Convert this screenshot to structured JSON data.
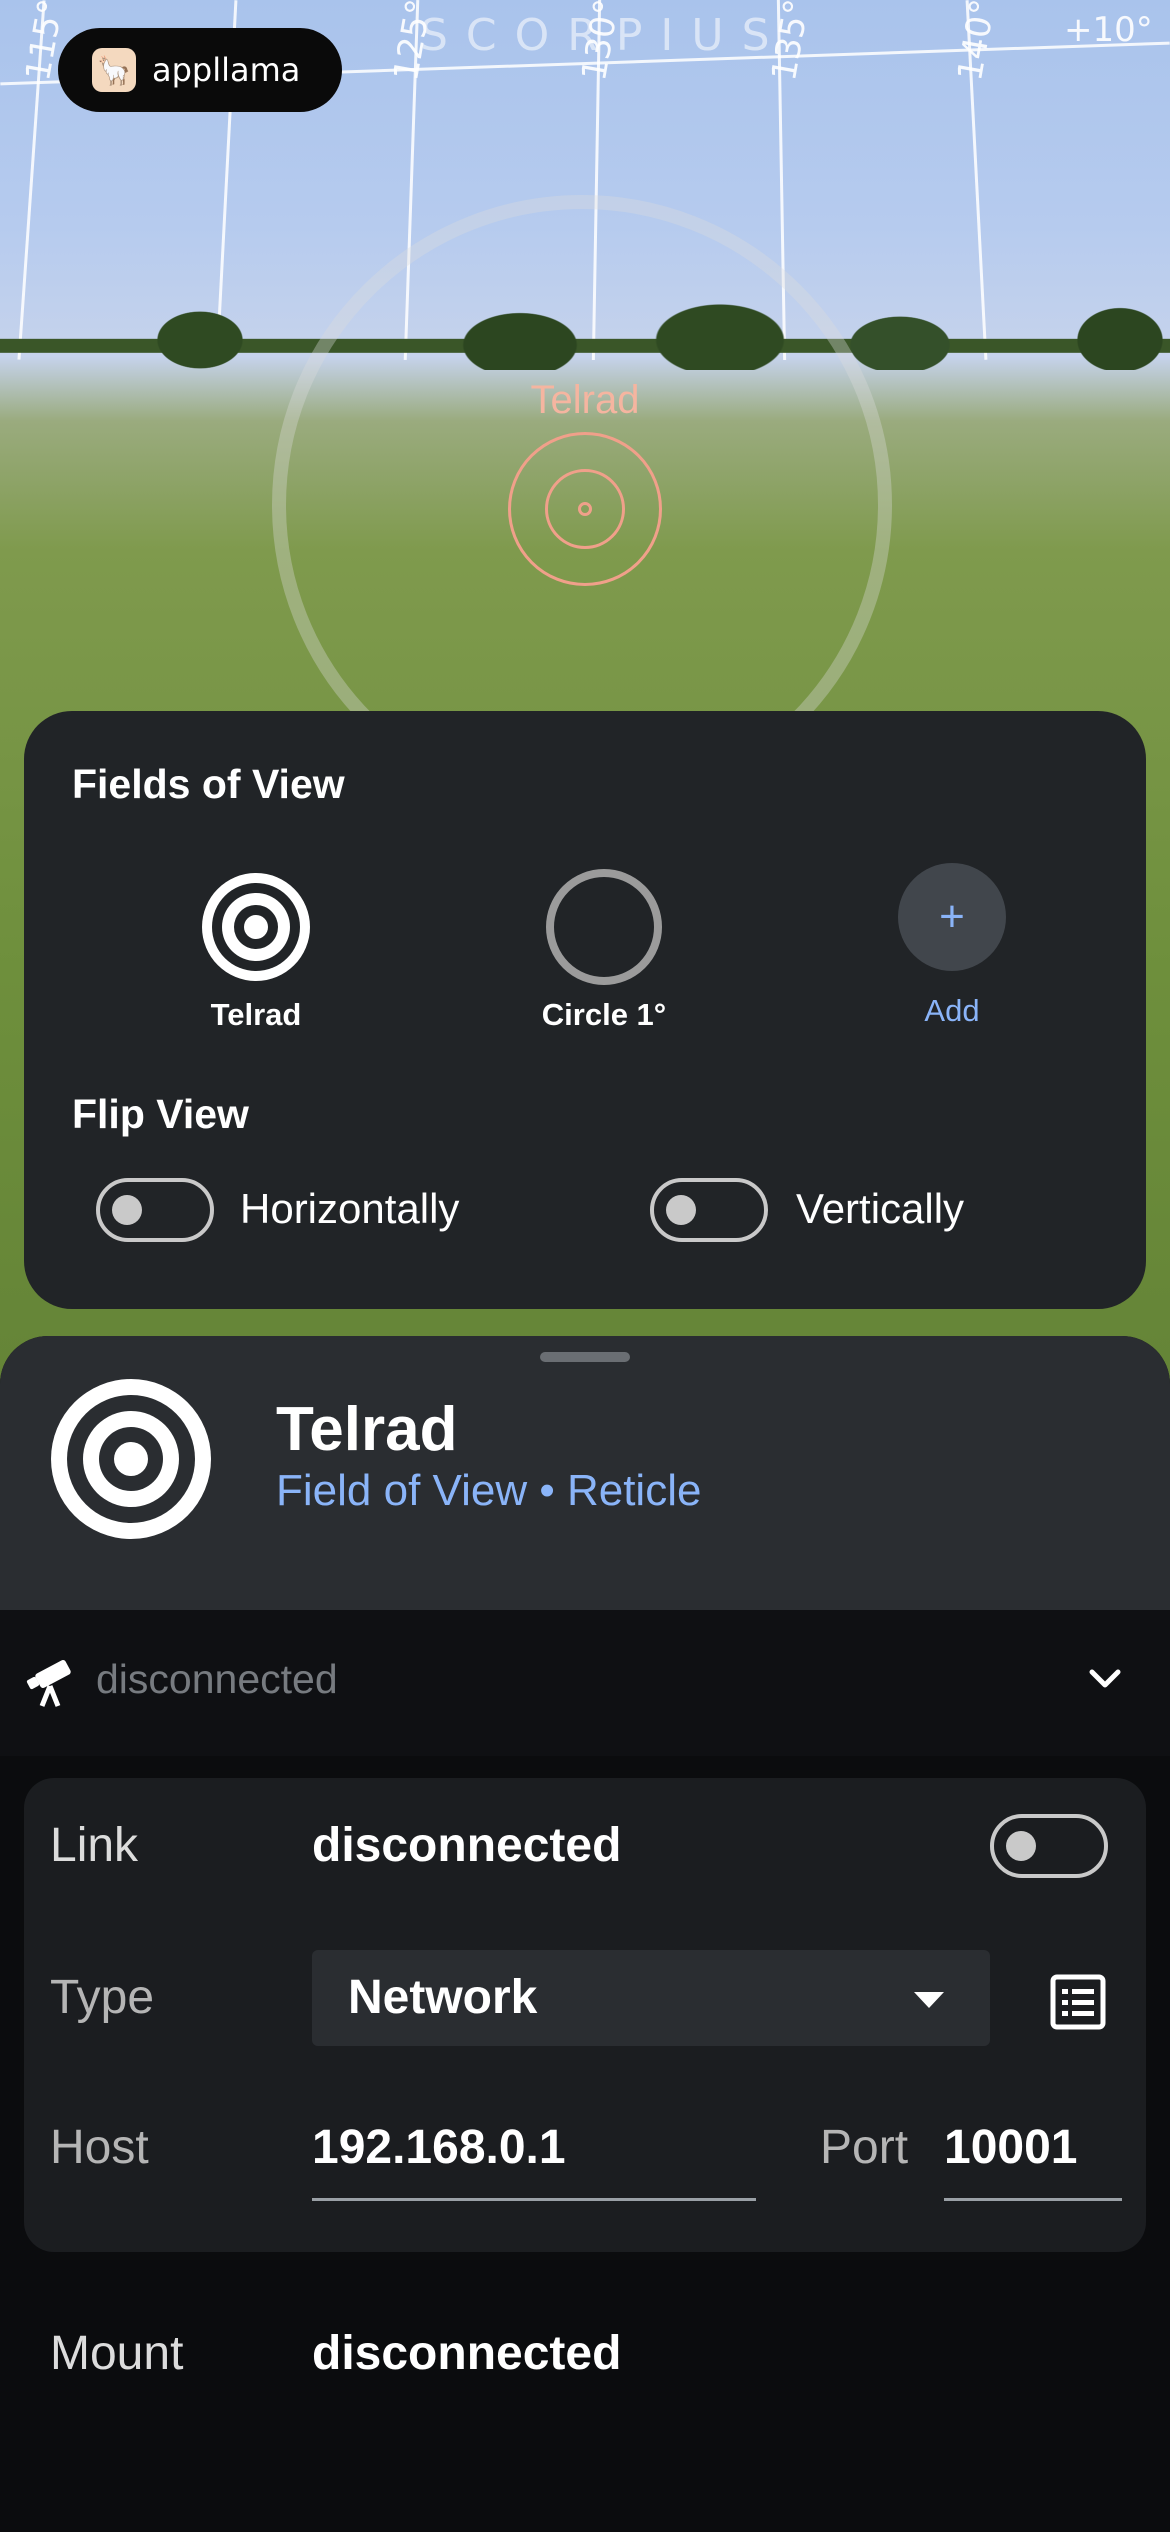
{
  "app": {
    "brand": "appllama"
  },
  "sky": {
    "constellation": "SCORPIUS",
    "degrees": [
      "115°",
      "125°",
      "130°",
      "135°",
      "140°",
      "+10°"
    ]
  },
  "overlay": {
    "fov_label": "Telrad",
    "reticle_color": "#f0a08a"
  },
  "fov_panel": {
    "title": "Fields of View",
    "items": [
      {
        "label": "Telrad",
        "icon": "telrad-reticle-icon"
      },
      {
        "label": "Circle 1°",
        "icon": "circle-icon"
      },
      {
        "label": "Add",
        "icon": "plus-icon"
      }
    ],
    "flip": {
      "title": "Flip View",
      "horizontal": {
        "label": "Horizontally",
        "on": false
      },
      "vertical": {
        "label": "Vertically",
        "on": false
      }
    }
  },
  "sheet": {
    "title": "Telrad",
    "subtitle": "Field of View • Reticle",
    "connection": {
      "status": "disconnected",
      "icon": "telescope-icon"
    },
    "link": {
      "label": "Link",
      "value": "disconnected",
      "on": false
    },
    "type": {
      "label": "Type",
      "value": "Network"
    },
    "host": {
      "label": "Host",
      "value": "192.168.0.1"
    },
    "port": {
      "label": "Port",
      "value": "10001"
    },
    "mount": {
      "label": "Mount",
      "value": "disconnected"
    }
  },
  "colors": {
    "accent": "#8ab4f8",
    "panel": "#212427",
    "sheet": "#0b0c0e"
  }
}
